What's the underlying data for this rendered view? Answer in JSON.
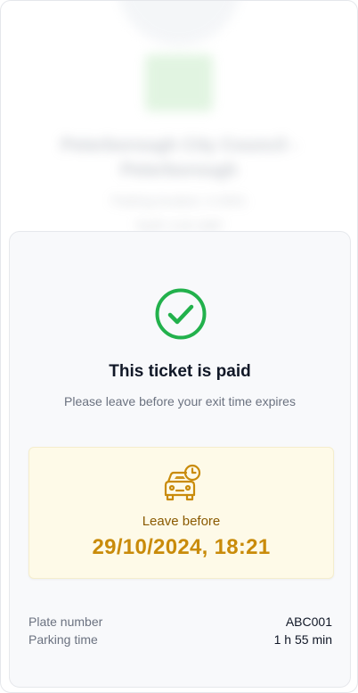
{
  "background": {
    "title": "Peterborough City Council - Peterborough",
    "meta1": "Parking location: A-0001",
    "meta2": "Tariff: 0.00 GBP"
  },
  "ticket": {
    "title": "This ticket is paid",
    "subtitle": "Please leave before your exit time expires",
    "leave_label": "Leave before",
    "leave_time": "29/10/2024, 18:21"
  },
  "details": [
    {
      "label": "Plate number",
      "value": "ABC001"
    },
    {
      "label": "Parking time",
      "value": "1 h 55 min"
    }
  ],
  "colors": {
    "success": "#22b14c",
    "accent": "#c98b0a",
    "leave_bg": "#fefae8"
  },
  "icons": {
    "status": "check-circle-icon",
    "leave": "car-clock-icon"
  }
}
